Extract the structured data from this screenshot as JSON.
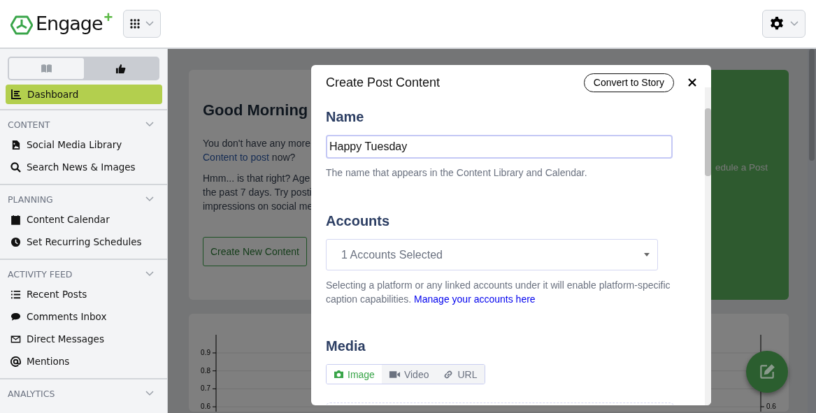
{
  "header": {
    "logo": {
      "name": "Engage",
      "plus": "+"
    }
  },
  "sidebar": {
    "view_toggle": [
      {
        "kind": "book",
        "selected": false
      },
      {
        "kind": "thumbs-up",
        "selected": true
      }
    ],
    "dashboard": {
      "label": "Dashboard",
      "selected": true
    },
    "sections": [
      {
        "title": "CONTENT",
        "expanded": true,
        "items": [
          {
            "label": "Social Media Library",
            "kind": "file-image"
          },
          {
            "label": "Search News & Images",
            "kind": "search"
          }
        ]
      },
      {
        "title": "PLANNING",
        "expanded": true,
        "items": [
          {
            "label": "Content Calendar",
            "kind": "calendar"
          },
          {
            "label": "Set Recurring Schedules",
            "kind": "clock"
          }
        ]
      },
      {
        "title": "ACTIVITY FEED",
        "expanded": true,
        "items": [
          {
            "label": "Recent Posts",
            "kind": "list"
          },
          {
            "label": "Comments Inbox",
            "kind": "comment"
          },
          {
            "label": "Direct Messages",
            "kind": "envelope"
          },
          {
            "label": "Mentions",
            "kind": "at"
          }
        ]
      },
      {
        "title": "ANALYTICS",
        "expanded": true
      }
    ]
  },
  "dashboard": {
    "greeting": {
      "title": "Good Morning",
      "para1": [
        "You don't have any more"
      ],
      "link": "Content to post",
      "link_after": " now?",
      "para2": [
        "Hmm... is that right? Age",
        "the past 7 days. Try posti",
        "impressions on social me"
      ],
      "button": "Create New Content"
    },
    "schedule_card": {
      "text": "edule a Post"
    },
    "chart": {
      "left_ticks": [
        "0.9",
        "0.8",
        "0.7",
        "0.6"
      ],
      "right_ticks": [
        "0.6"
      ]
    }
  },
  "modal": {
    "title": "Create Post Content",
    "convert_button": "Convert to Story",
    "name": {
      "label": "Name",
      "value": "Happy Tuesday",
      "help": "The name that appears in the Content Library and Calendar."
    },
    "accounts": {
      "label": "Accounts",
      "value": "1 Accounts Selected",
      "help": "Selecting a platform or any linked accounts under it will enable platform-specific caption capabilities.",
      "link": "Manage your accounts here"
    },
    "media": {
      "label": "Media",
      "tabs": [
        {
          "label": "Image",
          "kind": "camera",
          "selected": true
        },
        {
          "label": "Video",
          "kind": "video",
          "selected": false
        },
        {
          "label": "URL",
          "kind": "link",
          "selected": false
        }
      ]
    }
  }
}
